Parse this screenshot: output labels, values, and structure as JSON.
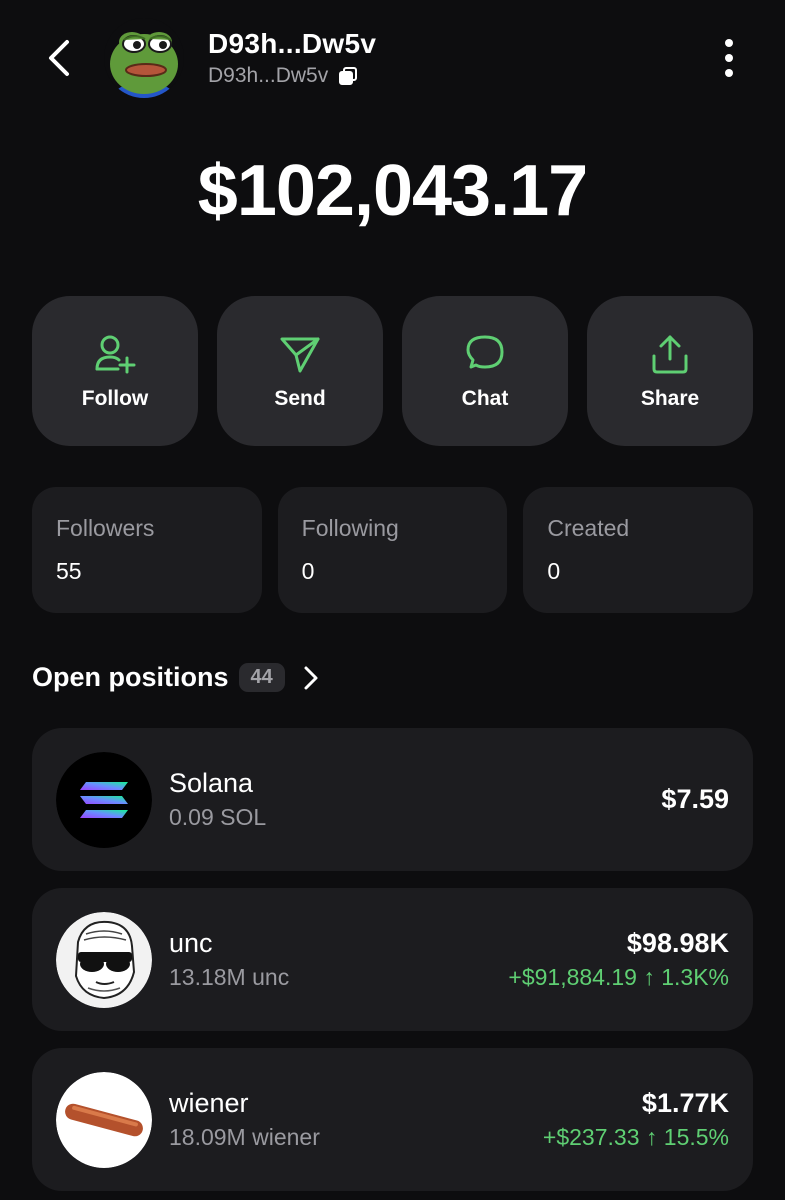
{
  "header": {
    "name": "D93h...Dw5v",
    "address": "D93h...Dw5v"
  },
  "balance": "$102,043.17",
  "actions": [
    {
      "label": "Follow",
      "icon": "user-plus-icon"
    },
    {
      "label": "Send",
      "icon": "send-icon"
    },
    {
      "label": "Chat",
      "icon": "chat-bubble-icon"
    },
    {
      "label": "Share",
      "icon": "share-icon"
    }
  ],
  "stats": [
    {
      "label": "Followers",
      "value": "55"
    },
    {
      "label": "Following",
      "value": "0"
    },
    {
      "label": "Created",
      "value": "0"
    }
  ],
  "positions": {
    "title": "Open positions",
    "count": "44",
    "items": [
      {
        "name": "Solana",
        "amount": "0.09 SOL",
        "value": "$7.59",
        "change": ""
      },
      {
        "name": "unc",
        "amount": "13.18M unc",
        "value": "$98.98K",
        "change": "+$91,884.19 ↑ 1.3K%"
      },
      {
        "name": "wiener",
        "amount": "18.09M wiener",
        "value": "$1.77K",
        "change": "+$237.33 ↑ 15.5%"
      }
    ]
  },
  "colors": {
    "accent": "#5fcf73",
    "background": "#0d0d0f",
    "button": "#2a2a2e",
    "card": "#1c1c1f",
    "muted_text": "#9a9aa0"
  }
}
